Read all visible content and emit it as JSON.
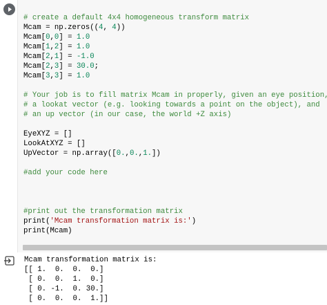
{
  "code_cell": {
    "run_icon": "play-icon",
    "lines": [
      [
        {
          "t": "# create a default 4x4 homogeneous transform matrix",
          "c": "comment"
        }
      ],
      [
        {
          "t": "Mcam = np.zeros(("
        },
        {
          "t": "4",
          "c": "num"
        },
        {
          "t": ", "
        },
        {
          "t": "4",
          "c": "num"
        },
        {
          "t": "))"
        }
      ],
      [
        {
          "t": "Mcam["
        },
        {
          "t": "0",
          "c": "num"
        },
        {
          "t": ","
        },
        {
          "t": "0",
          "c": "num"
        },
        {
          "t": "] = "
        },
        {
          "t": "1.0",
          "c": "num"
        }
      ],
      [
        {
          "t": "Mcam["
        },
        {
          "t": "1",
          "c": "num"
        },
        {
          "t": ","
        },
        {
          "t": "2",
          "c": "num"
        },
        {
          "t": "] = "
        },
        {
          "t": "1.0",
          "c": "num"
        }
      ],
      [
        {
          "t": "Mcam["
        },
        {
          "t": "2",
          "c": "num"
        },
        {
          "t": ","
        },
        {
          "t": "1",
          "c": "num"
        },
        {
          "t": "] = "
        },
        {
          "t": "-1.0",
          "c": "num"
        }
      ],
      [
        {
          "t": "Mcam["
        },
        {
          "t": "2",
          "c": "num"
        },
        {
          "t": ","
        },
        {
          "t": "3",
          "c": "num"
        },
        {
          "t": "] = "
        },
        {
          "t": "30.0",
          "c": "num"
        },
        {
          "t": ";"
        }
      ],
      [
        {
          "t": "Mcam["
        },
        {
          "t": "3",
          "c": "num"
        },
        {
          "t": ","
        },
        {
          "t": "3",
          "c": "num"
        },
        {
          "t": "] = "
        },
        {
          "t": "1.0",
          "c": "num"
        }
      ],
      [],
      [
        {
          "t": "# Your job is to fill matrix Mcam in properly, given an eye position,",
          "c": "comment"
        }
      ],
      [
        {
          "t": "# a lookat vector (e.g. looking towards a point on the object), and",
          "c": "comment"
        }
      ],
      [
        {
          "t": "# an up vector (in our case, the world +Z axis)",
          "c": "comment"
        }
      ],
      [],
      [
        {
          "t": "EyeXYZ = []"
        }
      ],
      [
        {
          "t": "LookAtXYZ = []"
        }
      ],
      [
        {
          "t": "UpVector = np.array(["
        },
        {
          "t": "0.",
          "c": "num"
        },
        {
          "t": ","
        },
        {
          "t": "0.",
          "c": "num"
        },
        {
          "t": ","
        },
        {
          "t": "1.",
          "c": "num"
        },
        {
          "t": "])"
        }
      ],
      [],
      [
        {
          "t": "#add your code here",
          "c": "comment"
        }
      ],
      [],
      [],
      [],
      [
        {
          "t": "#print out the transformation matrix",
          "c": "comment"
        }
      ],
      [
        {
          "t": "print("
        },
        {
          "t": "'Mcam transformation matrix is:'",
          "c": "str"
        },
        {
          "t": ")"
        }
      ],
      [
        {
          "t": "print(Mcam)"
        }
      ]
    ]
  },
  "output_cell": {
    "icon": "output-arrow-icon",
    "lines": [
      "Mcam transformation matrix is:",
      "[[ 1.  0.  0.  0.]",
      " [ 0.  0.  1.  0.]",
      " [ 0. -1.  0. 30.]",
      " [ 0.  0.  0.  1.]]"
    ]
  }
}
